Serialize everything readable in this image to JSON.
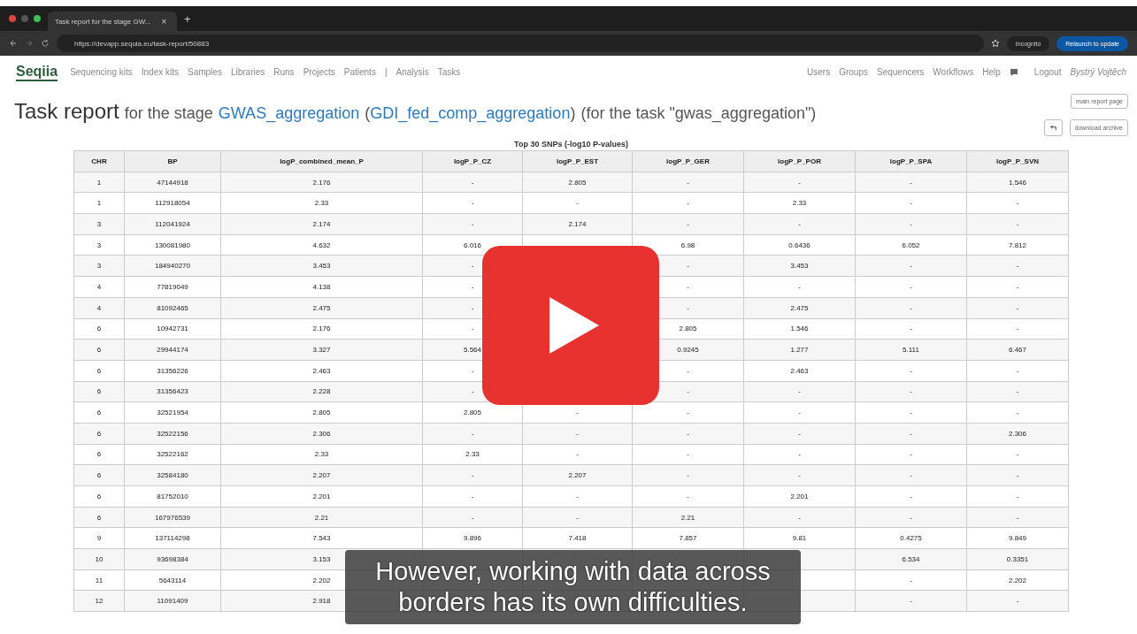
{
  "browser": {
    "tab_title": "Task report for the stage GW...",
    "tab_close": "×",
    "new_tab": "+",
    "url": "https://devapp.sequia.eu/task-report/50883",
    "incognito": "Incognito",
    "relaunch": "Relaunch to update"
  },
  "navbar": {
    "logo": "Seqiia",
    "left": [
      "Sequencing kits",
      "Index kits",
      "Samples",
      "Libraries",
      "Runs",
      "Projects",
      "Patients",
      "|",
      "Analysis",
      "Tasks"
    ],
    "right": [
      "Users",
      "Groups",
      "Sequencers",
      "Workflows",
      "Help"
    ],
    "logout": "Logout",
    "user": "Bystrý Vojtěch"
  },
  "title": {
    "main": "Task report",
    "pre": "for the stage",
    "stage": "GWAS_aggregation",
    "open": "(",
    "workflow": "GDI_fed_comp_aggregation",
    "close": ")",
    "task": "(for the task \"gwas_aggregation\")"
  },
  "buttons": {
    "main_report": "main report page",
    "download": "download archive"
  },
  "table": {
    "caption": "Top 30 SNPs (-log10 P-values)",
    "columns": [
      "CHR",
      "BP",
      "logP_combined_mean_P",
      "logP_P_CZ",
      "logP_P_EST",
      "logP_P_GER",
      "logP_P_POR",
      "logP_P_SPA",
      "logP_P_SVN"
    ],
    "rows": [
      [
        "1",
        "47144918",
        "2.176",
        "-",
        "2.805",
        "-",
        "-",
        "-",
        "1.546"
      ],
      [
        "1",
        "112918054",
        "2.33",
        "-",
        "-",
        "-",
        "2.33",
        "-",
        "-"
      ],
      [
        "3",
        "112041924",
        "2.174",
        "-",
        "2.174",
        "-",
        "-",
        "-",
        "-"
      ],
      [
        "3",
        "130081980",
        "4.632",
        "6.016",
        null,
        "6.98",
        "0.6436",
        "6.052",
        "7.812"
      ],
      [
        "3",
        "184940270",
        "3.453",
        "-",
        null,
        "-",
        "3.453",
        "-",
        "-"
      ],
      [
        "4",
        "77819049",
        "4.138",
        "-",
        null,
        "-",
        "-",
        "-",
        "-"
      ],
      [
        "4",
        "81092465",
        "2.475",
        "-",
        null,
        "-",
        "2.475",
        "-",
        "-"
      ],
      [
        "6",
        "10942731",
        "2.176",
        "-",
        null,
        "2.805",
        "1.546",
        "-",
        "-"
      ],
      [
        "6",
        "29944174",
        "3.327",
        "5.564",
        null,
        "0.9245",
        "1.277",
        "5.111",
        "6.467"
      ],
      [
        "6",
        "31356226",
        "2.463",
        "-",
        null,
        "-",
        "2.463",
        "-",
        "-"
      ],
      [
        "6",
        "31356423",
        "2.228",
        "-",
        null,
        "-",
        "-",
        "-",
        "-"
      ],
      [
        "6",
        "32521954",
        "2.805",
        "2.805",
        "-",
        "-",
        "-",
        "-",
        "-"
      ],
      [
        "6",
        "32522156",
        "2.306",
        "-",
        "-",
        "-",
        "-",
        "-",
        "2.306"
      ],
      [
        "6",
        "32522162",
        "2.33",
        "2.33",
        "-",
        "-",
        "-",
        "-",
        "-"
      ],
      [
        "6",
        "32584180",
        "2.207",
        "-",
        "2.207",
        "-",
        "-",
        "-",
        "-"
      ],
      [
        "6",
        "81752010",
        "2.201",
        "-",
        "-",
        "-",
        "2.201",
        "-",
        "-"
      ],
      [
        "6",
        "167976539",
        "2.21",
        "-",
        "-",
        "2.21",
        "-",
        "-",
        "-"
      ],
      [
        "9",
        "137114298",
        "7.543",
        "9.896",
        "7.418",
        "7.857",
        "9.81",
        "0.4275",
        "9.849"
      ],
      [
        "10",
        "93698384",
        "3.153",
        null,
        null,
        null,
        null,
        "6.534",
        "0.3351"
      ],
      [
        "11",
        "5643114",
        "2.202",
        null,
        null,
        null,
        null,
        "-",
        "2.202"
      ],
      [
        "12",
        "11091409",
        "2.918",
        null,
        null,
        null,
        null,
        "-",
        "-"
      ]
    ]
  },
  "video": {
    "subtitle": "However, working with data across\nborders has its own difficulties."
  }
}
